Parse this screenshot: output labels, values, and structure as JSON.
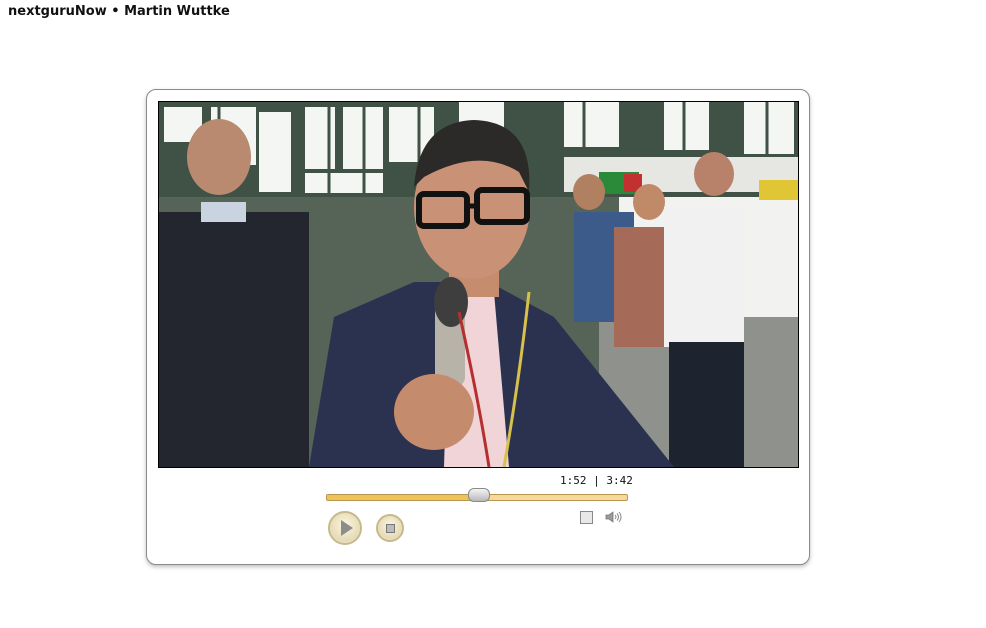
{
  "page": {
    "title": "nextguruNow • Martin Wuttke"
  },
  "player": {
    "time_current": "1:52",
    "time_separator": "|",
    "time_total": "3:42",
    "progress": 0.505,
    "icons": {
      "play": "play-icon",
      "stop": "stop-icon",
      "fullscreen": "fullscreen-icon",
      "volume": "volume-icon"
    },
    "colors": {
      "track": "#f6d89b",
      "track_fill": "#f0c35a",
      "frame_border": "#8a8a8a"
    }
  }
}
